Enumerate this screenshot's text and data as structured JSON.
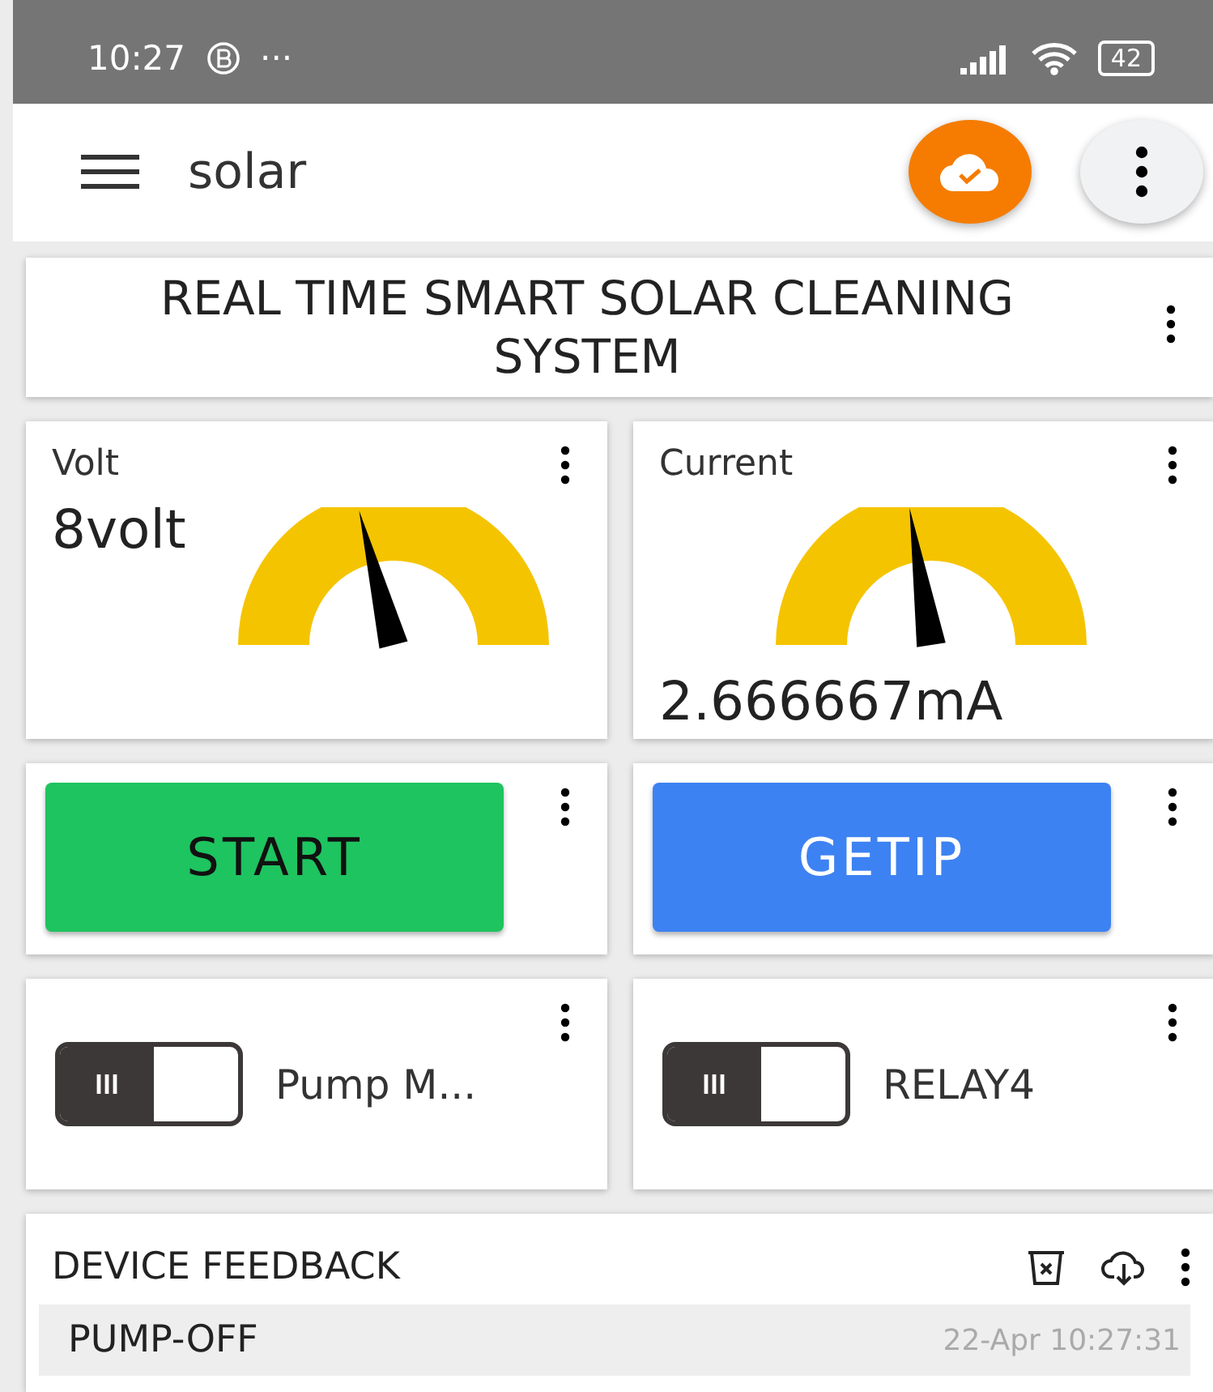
{
  "status_bar": {
    "time": "10:27",
    "dots": "···",
    "battery": "42"
  },
  "app_bar": {
    "title": "solar"
  },
  "title_card": {
    "text": "REAL TIME SMART SOLAR CLEANING SYSTEM"
  },
  "gauges": [
    {
      "label": "Volt",
      "value": "8volt",
      "kind": "side",
      "level": 0.42
    },
    {
      "label": "Current",
      "value": "2.666667mA",
      "kind": "below",
      "level": 0.45
    }
  ],
  "buttons": [
    {
      "label": "START",
      "color": "#1ec45f"
    },
    {
      "label": "GETIP",
      "color": "#3d82f2"
    }
  ],
  "switches": [
    {
      "label": "Pump M...",
      "on": false
    },
    {
      "label": "RELAY4",
      "on": false
    }
  ],
  "feedback": {
    "title": "DEVICE FEEDBACK",
    "rows": [
      {
        "message": "PUMP-OFF",
        "time": "22-Apr 10:27:31"
      }
    ]
  }
}
